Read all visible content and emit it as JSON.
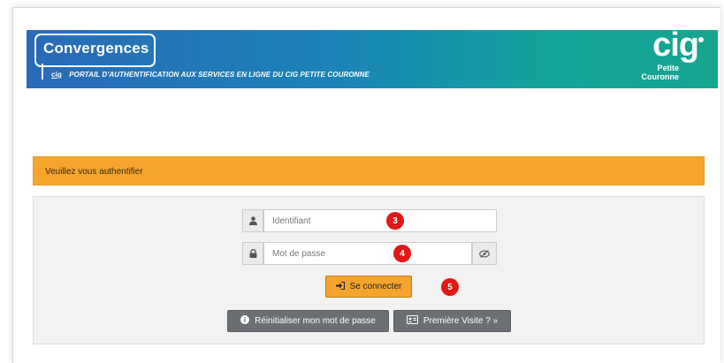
{
  "banner": {
    "logo_text": "Convergences",
    "cig_mini": "cig",
    "subtitle": "PORTAIL D'AUTHENTIFICATION AUX SERVICES EN LIGNE DU CIG PETITE COURONNE",
    "brand_word": "cig",
    "brand_line1": "Petite",
    "brand_line2": "Couronne",
    "colors": {
      "gradient_start": "#2a6ab8",
      "gradient_end": "#16a58f"
    }
  },
  "auth_header": {
    "text": "Veuillez vous authentifier",
    "color": "#f5a42d"
  },
  "form": {
    "username": {
      "placeholder": "Identifiant",
      "icon": "user-icon",
      "badge": "3"
    },
    "password": {
      "placeholder": "Mot de passe",
      "icon": "lock-icon",
      "toggle_icon": "eye-slash-icon",
      "badge": "4"
    },
    "login_button": {
      "label": "Se connecter",
      "icon": "sign-in-icon",
      "badge": "5"
    },
    "reset_button": {
      "label": "Réinitialiser mon mot de passe",
      "icon": "info-circle-icon"
    },
    "first_visit_button": {
      "label": "Première Visite ? »",
      "icon": "id-card-icon"
    }
  }
}
